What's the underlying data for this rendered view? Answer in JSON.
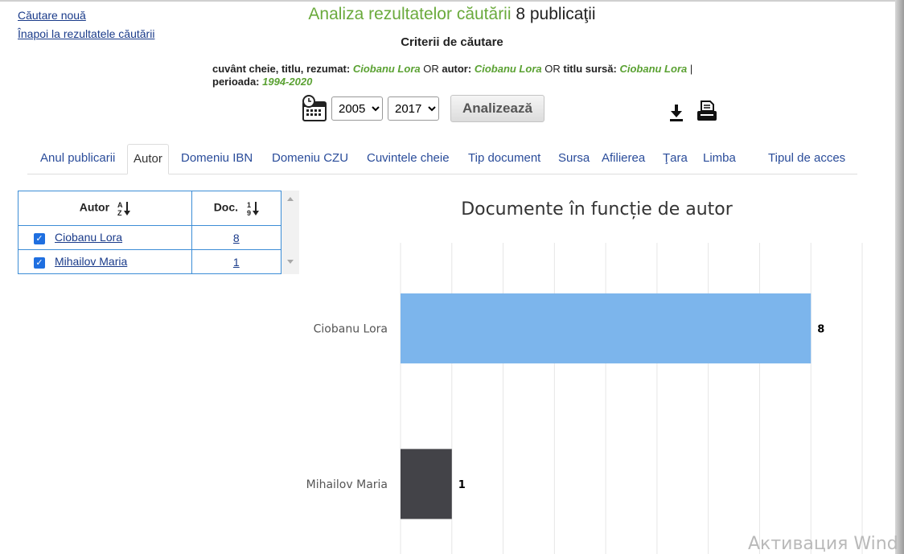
{
  "nav": {
    "new_search": "Căutare nouă",
    "back_to_results": "Înapoi la rezultatele căutării"
  },
  "title": {
    "main": "Analiza rezultatelor căutării",
    "count": "8 publicaţii"
  },
  "criteria": {
    "heading": "Criterii de căutare",
    "kw_label": "cuvânt cheie, titlu, rezumat:",
    "kw_value": "Ciobanu Lora",
    "or1": "OR",
    "author_label": "autor:",
    "author_value": "Ciobanu Lora",
    "or2": "OR",
    "source_label": "titlu sursă:",
    "source_value": "Ciobanu Lora",
    "sep": "|",
    "period_label": "perioada:",
    "period_value": "1994-2020"
  },
  "controls": {
    "year_from": {
      "selected": "2005",
      "options": [
        "2005"
      ]
    },
    "year_to": {
      "selected": "2017",
      "options": [
        "2017"
      ]
    },
    "analyze_label": "Analizează",
    "icons": {
      "calendar": "calendar-clock-icon",
      "download": "download-icon",
      "print": "print-icon"
    }
  },
  "tabs": [
    {
      "label": "Anul publicarii"
    },
    {
      "label": "Autor",
      "active": true
    },
    {
      "label": "Domeniu IBN"
    },
    {
      "label": "Domeniu CZU"
    },
    {
      "label": "Cuvintele cheie"
    },
    {
      "label": "Tip document"
    },
    {
      "label": "Sursa"
    },
    {
      "label": "Afilierea"
    },
    {
      "label": "Ţara"
    },
    {
      "label": "Limba"
    },
    {
      "label": "Tipul de acces"
    }
  ],
  "author_table": {
    "headers": {
      "author": "Autor",
      "docs": "Doc."
    },
    "rows": [
      {
        "name": "Ciobanu Lora",
        "docs": "8",
        "checked": true
      },
      {
        "name": "Mihailov Maria",
        "docs": "1",
        "checked": true
      }
    ]
  },
  "chart_data": {
    "type": "bar",
    "orientation": "horizontal",
    "title": "Documente în funcție de autor",
    "categories": [
      "Ciobanu Lora",
      "Mihailov Maria"
    ],
    "values": [
      8,
      1
    ],
    "colors": [
      "#7cb5ec",
      "#434348"
    ],
    "data_labels": [
      "8",
      "1"
    ],
    "xlim": [
      0,
      9
    ],
    "grid": true
  },
  "watermark": "Активация Wind",
  "colors": {
    "accent_green": "#6aaa3c",
    "link_blue": "#1a3b8a",
    "table_border": "#3c8dd6"
  }
}
